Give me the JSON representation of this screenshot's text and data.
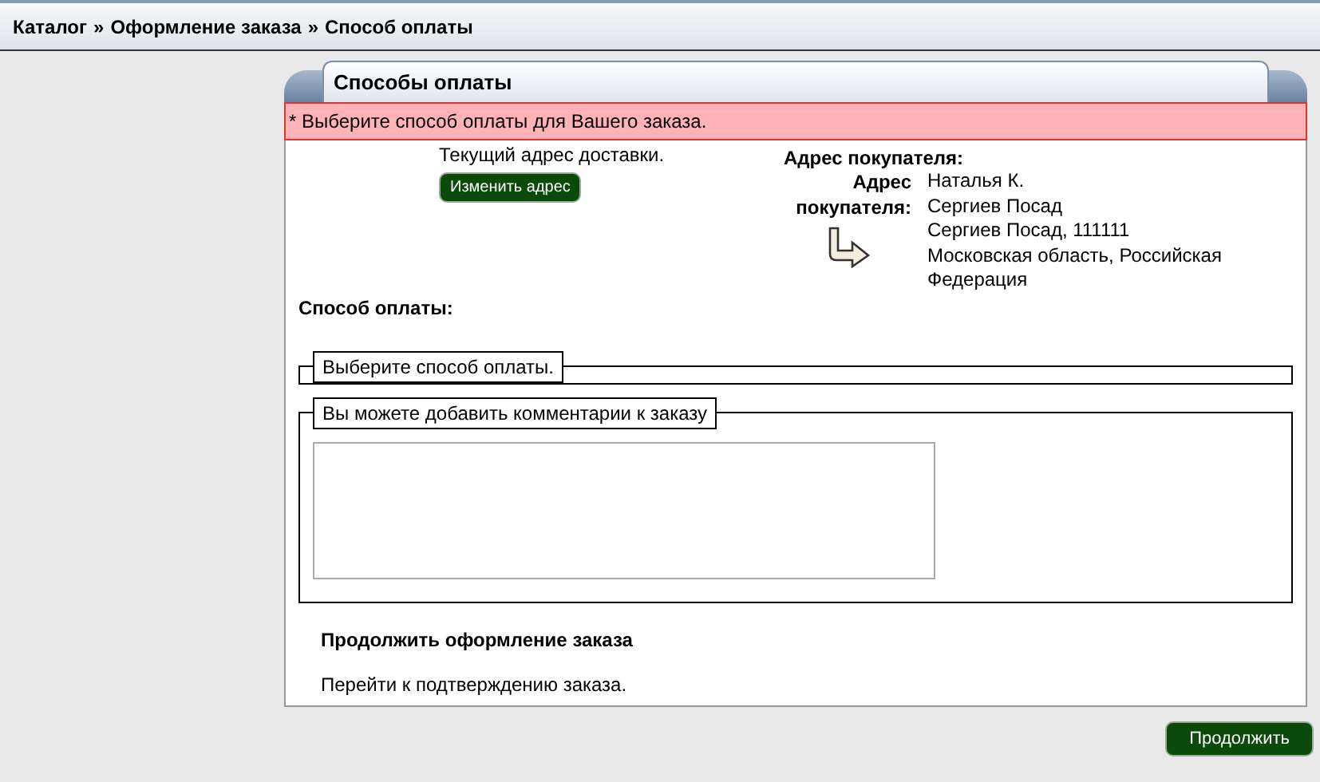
{
  "breadcrumb": {
    "items": [
      "Каталог",
      "Оформление заказа",
      "Способ оплаты"
    ],
    "separator": "»"
  },
  "panel": {
    "title": "Способы оплаты"
  },
  "alert": "* Выберите способ оплаты для Вашего заказа.",
  "shipping": {
    "label": "Текущий адрес доставки.",
    "button": "Изменить адрес"
  },
  "billing": {
    "heading": "Адрес покупателя:",
    "label": "Адрес покупателя:",
    "lines": [
      "Наталья К.",
      "Сергиев Посад",
      "Сергиев Посад, 111111",
      "Московская область, Российская Федерация"
    ]
  },
  "payment": {
    "heading": "Способ оплаты:",
    "legend": "Выберите способ оплаты."
  },
  "comments": {
    "legend": "Вы можете добавить комментарии к заказу"
  },
  "continue_section": {
    "heading": "Продолжить оформление заказа",
    "text": "Перейти к подтверждению заказа."
  },
  "continue_button": "Продолжить"
}
